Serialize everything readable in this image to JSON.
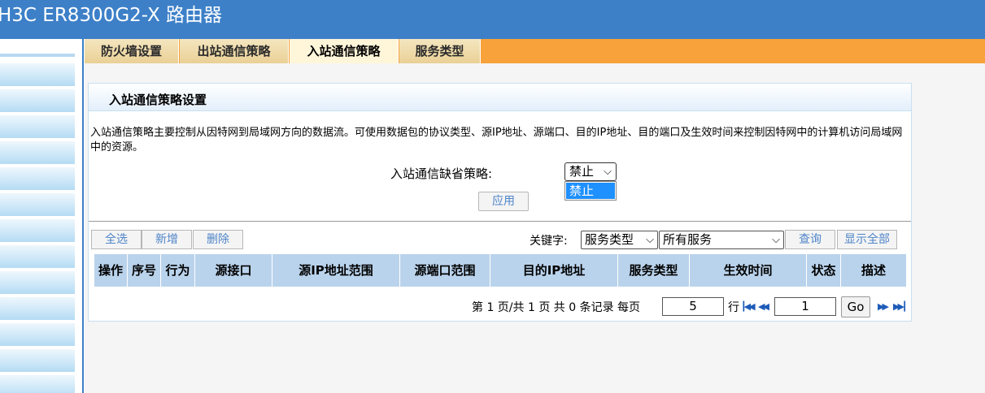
{
  "header": {
    "title": "H3C ER8300G2-X 路由器"
  },
  "tabs": [
    {
      "label": "防火墙设置",
      "active": false
    },
    {
      "label": "出站通信策略",
      "active": false
    },
    {
      "label": "入站通信策略",
      "active": true
    },
    {
      "label": "服务类型",
      "active": false
    }
  ],
  "panel": {
    "title": "入站通信策略设置",
    "description": "入站通信策略主要控制从因特网到局域网方向的数据流。可使用数据包的协议类型、源IP地址、源端口、目的IP地址、目的端口及生效时间来控制因特网中的计算机访问局域网中的资源。",
    "default_policy_label": "入站通信缺省策略:",
    "default_policy_value": "禁止",
    "default_policy_options": [
      "禁止"
    ],
    "apply_label": "应用"
  },
  "toolbar": {
    "select_all": "全选",
    "add": "新增",
    "delete": "删除",
    "keyword_label": "关键字:",
    "keyword_field": "服务类型",
    "keyword_value": "所有服务",
    "search": "查询",
    "show_all": "显示全部"
  },
  "table": {
    "columns": [
      "操作",
      "序号",
      "行为",
      "源接口",
      "源IP地址范围",
      "源端口范围",
      "目的IP地址",
      "服务类型",
      "生效时间",
      "状态",
      "描述"
    ],
    "rows": []
  },
  "pager": {
    "summary": "第 1 页/共 1 页 共 0 条记录 每页",
    "per_page": "5",
    "rows_unit": "行",
    "page_input": "1",
    "go_label": "Go"
  },
  "colors": {
    "header_bg": "#3d80c8",
    "tab_bar": "#f7a23a",
    "table_header": "#bad3ec",
    "dropdown_highlight": "#1e90ff"
  }
}
